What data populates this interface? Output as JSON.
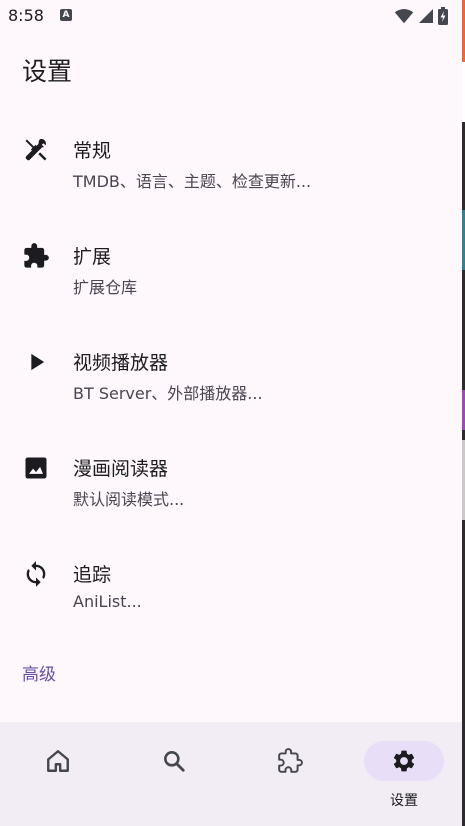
{
  "status_bar": {
    "time": "8:58",
    "notification_icon": "a-icon"
  },
  "page": {
    "title": "设置"
  },
  "settings": [
    {
      "title": "常规",
      "subtitle": "TMDB、语言、主题、检查更新...",
      "icon": "tools-icon"
    },
    {
      "title": "扩展",
      "subtitle": "扩展仓库",
      "icon": "extension-icon"
    },
    {
      "title": "视频播放器",
      "subtitle": "BT Server、外部播放器...",
      "icon": "play-icon"
    },
    {
      "title": "漫画阅读器",
      "subtitle": "默认阅读模式...",
      "icon": "image-icon"
    },
    {
      "title": "追踪",
      "subtitle": "AniList...",
      "icon": "sync-icon"
    }
  ],
  "advanced_section": {
    "label": "高级"
  },
  "bottom_nav": {
    "items": [
      {
        "icon": "home-icon",
        "label": ""
      },
      {
        "icon": "search-icon",
        "label": ""
      },
      {
        "icon": "extension-icon",
        "label": ""
      },
      {
        "icon": "gear-icon",
        "label": "设置",
        "active": true
      }
    ]
  },
  "colors": {
    "background": "#fef8fd",
    "accent": "#6750a4",
    "nav_background": "#f2edf4",
    "active_pill": "#e8def8"
  }
}
